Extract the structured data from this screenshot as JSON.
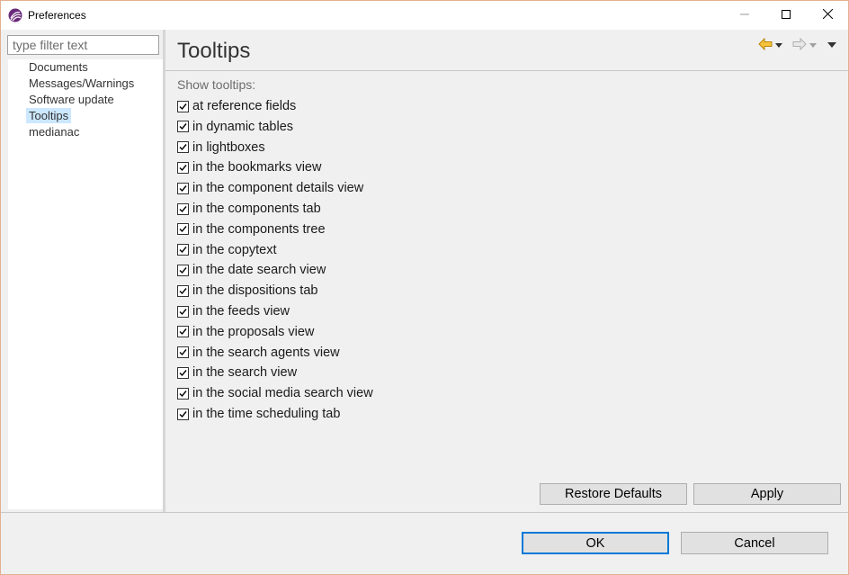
{
  "window": {
    "title": "Preferences",
    "icon": "app-logo-icon",
    "controls": [
      "minimize-icon",
      "maximize-icon",
      "close-icon"
    ]
  },
  "sidebar": {
    "filter_placeholder": "type filter text",
    "items": [
      {
        "label": "Documents",
        "selected": false
      },
      {
        "label": "Messages/Warnings",
        "selected": false
      },
      {
        "label": "Software update",
        "selected": false
      },
      {
        "label": "Tooltips",
        "selected": true
      },
      {
        "label": "medianac",
        "selected": false
      }
    ]
  },
  "page": {
    "title": "Tooltips",
    "nav_icons": [
      "back-arrow-icon",
      "back-dropdown-icon",
      "forward-arrow-icon",
      "forward-dropdown-icon",
      "view-menu-icon"
    ],
    "section_label": "Show tooltips:",
    "options": [
      {
        "label": "at reference fields",
        "checked": true
      },
      {
        "label": "in dynamic tables",
        "checked": true
      },
      {
        "label": "in lightboxes",
        "checked": true
      },
      {
        "label": "in the bookmarks view",
        "checked": true
      },
      {
        "label": "in the component details view",
        "checked": true
      },
      {
        "label": "in the components tab",
        "checked": true
      },
      {
        "label": "in the components tree",
        "checked": true
      },
      {
        "label": "in the copytext",
        "checked": true
      },
      {
        "label": "in the date search view",
        "checked": true
      },
      {
        "label": "in the dispositions tab",
        "checked": true
      },
      {
        "label": "in the feeds view",
        "checked": true
      },
      {
        "label": "in the proposals view",
        "checked": true
      },
      {
        "label": "in the search agents view",
        "checked": true
      },
      {
        "label": "in the search view",
        "checked": true
      },
      {
        "label": "in the social media search view",
        "checked": true
      },
      {
        "label": "in the time scheduling tab",
        "checked": true
      }
    ],
    "restore_defaults_label": "Restore Defaults",
    "apply_label": "Apply"
  },
  "footer": {
    "ok_label": "OK",
    "cancel_label": "Cancel"
  },
  "colors": {
    "accent": "#0078d7",
    "selection": "#cce8ff",
    "nav_back": "#e0a000",
    "window_border": "#e3b08f"
  }
}
